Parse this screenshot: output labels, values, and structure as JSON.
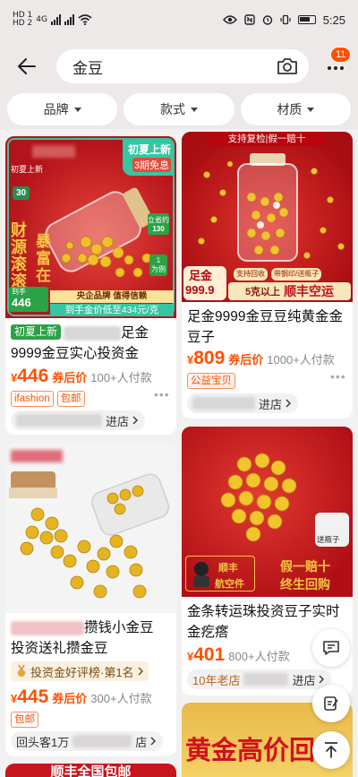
{
  "status_bar": {
    "sim_labels": [
      "HD 1",
      "HD 2"
    ],
    "network": "4G",
    "time": "5:25"
  },
  "search": {
    "query": "金豆",
    "notification_count": "11"
  },
  "filters": [
    {
      "label": "品牌"
    },
    {
      "label": "款式"
    },
    {
      "label": "材质"
    }
  ],
  "products": [
    {
      "image_text": {
        "corner_tag": "初夏上新",
        "corner_sub": "3期免息",
        "left_tag": "初夏上新",
        "side_badge": "30",
        "vertical_text": "财源滚滚",
        "big_text": "暴富在",
        "vertical_right_1": "立省约",
        "vertical_right_1_num": "130",
        "vertical_right_2": "1",
        "vertical_right_2_sub": "为例",
        "price_label": "到手",
        "price_num": "446",
        "bottom_strip": "央企品牌 值得信赖",
        "bottom_price": "到手金价低至434元/克"
      },
      "badge": "初夏上新",
      "title_tail": "足金",
      "title_line2": "9999金豆实心投资金",
      "price_symbol": "¥",
      "price": "446",
      "price_note": "券后价",
      "sales": "100+人付款",
      "tags": [
        "ifashion",
        "包邮"
      ],
      "store_suffix": "进店"
    },
    {
      "image_text": {
        "top_banner": "支持复检|假一赔十",
        "left_tag_top": "足金",
        "left_tag_num": "999.9",
        "mid_strip_1": "支持回收",
        "mid_strip_2": "带钢印/送瓶子",
        "bottom_strip": "5克以上",
        "bottom_strip_strong": "顺丰空运"
      },
      "title": "足金9999金豆豆纯黄金金豆子",
      "price_symbol": "¥",
      "price": "809",
      "price_note": "券后价",
      "sales": "1000+人付款",
      "tags": [
        "公益宝贝"
      ],
      "store_suffix": "进店"
    },
    {
      "title_tail": "攒钱小金豆",
      "title_line2": "投资送礼攒金豆",
      "rank_text": "投资金好评榜·第1名",
      "price_symbol": "¥",
      "price": "445",
      "price_note": "券后价",
      "sales": "300+人付款",
      "tags": [
        "包邮"
      ],
      "store_prefix": "回头客1万",
      "store_suffix": "店"
    },
    {
      "image_text": {
        "corner_label": "送瓶子",
        "left_line_1": "顺丰",
        "left_line_2": "航空件",
        "right_line_1": "假一赔十",
        "right_line_2": "终生回购"
      },
      "title": "金条转运珠投资豆子实时金疙瘩",
      "price_symbol": "¥",
      "price": "401",
      "sales": "800+人付款",
      "store_prefix": "10年老店",
      "store_suffix": "进店"
    },
    {
      "image_text": {
        "banner": "顺丰全国包邮"
      }
    },
    {
      "image_text": {
        "banner": "黄金高价回"
      }
    }
  ]
}
